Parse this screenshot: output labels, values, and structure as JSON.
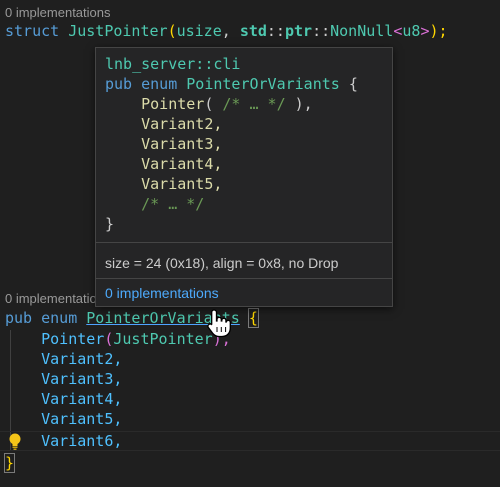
{
  "top": {
    "lens": "0 implementations",
    "struct_kw": "struct",
    "struct_name": "JustPointer",
    "open_paren": "(",
    "t_usize": "usize",
    "comma": ", ",
    "std": "std",
    "sep1": "::",
    "ptr": "ptr",
    "sep2": "::",
    "nonnull": "NonNull",
    "lt": "<",
    "u8": "u8",
    "gt": ">",
    "close": ");"
  },
  "hover": {
    "module": "lnb_server::cli",
    "sig_kw": "pub enum ",
    "sig_name": "PointerOrVariants",
    "sig_brace": " {",
    "variant_pointer": "Pointer",
    "variant_pointer_open": "( ",
    "variant_pointer_cmt": "/* … */",
    "variant_pointer_close": " ),",
    "variants": [
      "Variant2,",
      "Variant3,",
      "Variant4,",
      "Variant5,"
    ],
    "trailing_comment": "/* … */",
    "close_brace": "}",
    "layout_info": "size = 24 (0x18), align = 0x8, no Drop",
    "implementations_link": "0 implementations"
  },
  "bottom": {
    "lens": "0 implementations",
    "pub": "pub",
    "enum": "enum",
    "name": "PointerOrVariants",
    "brace_open": "{",
    "pointer": "Pointer",
    "pointer_open": "(",
    "pointer_arg": "JustPointer",
    "pointer_close": "),",
    "variants": [
      "Variant2,",
      "Variant3,",
      "Variant4,",
      "Variant5,",
      "Variant6,"
    ],
    "brace_close": "}"
  },
  "icons": {
    "lightbulb": "lightbulb-icon",
    "cursor": "hand-pointer-icon"
  },
  "colors": {
    "background": "#1f1f1f",
    "keyword": "#569cd6",
    "type": "#4ec9b0",
    "function": "#dcdcaa",
    "enum_member": "#4fc1ff",
    "comment": "#6a9955",
    "link": "#4daafc",
    "bracket_gold": "#ffd700",
    "bracket_purple": "#da70d6",
    "bracket_blue": "#179fff",
    "lightbulb": "#f5c518"
  }
}
